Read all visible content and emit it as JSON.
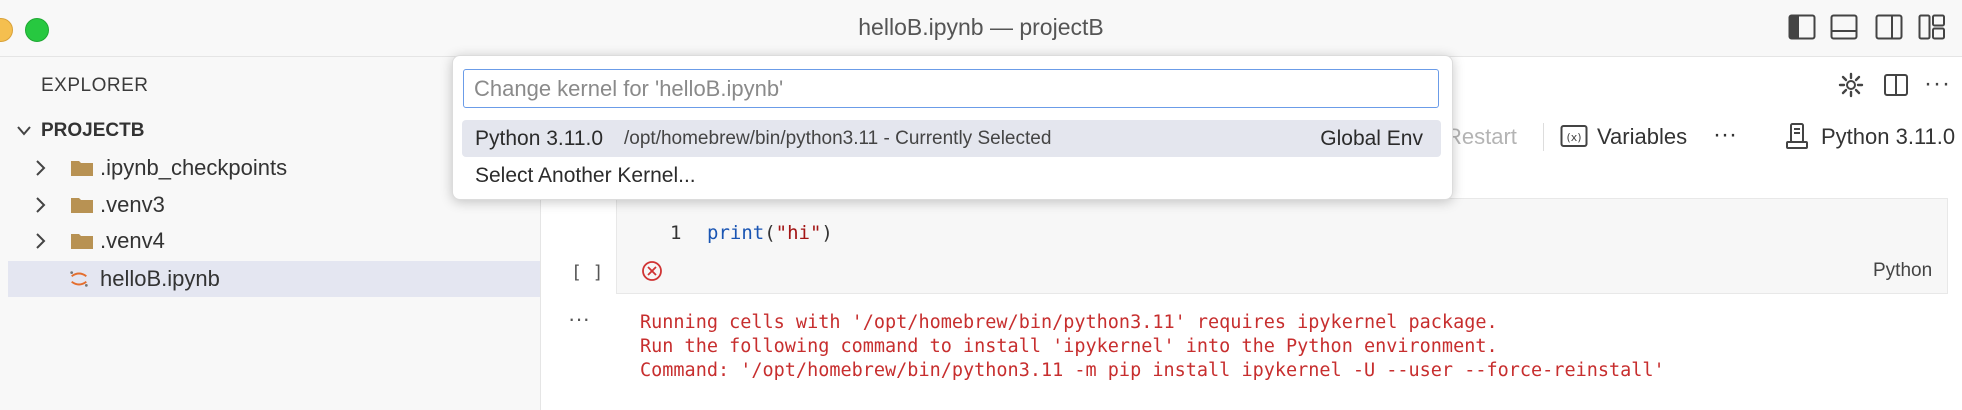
{
  "window": {
    "title": "helloB.ipynb — projectB"
  },
  "explorer": {
    "title": "EXPLORER",
    "root": "PROJECTB",
    "items": [
      {
        "label": ".ipynb_checkpoints",
        "type": "folder"
      },
      {
        "label": ".venv3",
        "type": "folder"
      },
      {
        "label": ".venv4",
        "type": "folder"
      },
      {
        "label": "helloB.ipynb",
        "type": "notebook",
        "selected": true
      }
    ]
  },
  "notebook_toolbar": {
    "restart_label": "Restart",
    "variables_label": "Variables",
    "more_label": "···",
    "kernel_label": "Python 3.11.0"
  },
  "cell": {
    "line_number": "1",
    "code_fn": "print",
    "code_open": "(",
    "code_str": "\"hi\"",
    "code_close": ")",
    "exec_brackets": "[ ]",
    "language": "Python",
    "output_menu": "···",
    "error_lines": [
      "Running cells with '/opt/homebrew/bin/python3.11' requires ipykernel package.",
      "Run the following command to install 'ipykernel' into the Python environment.",
      "Command: '/opt/homebrew/bin/python3.11 -m pip install ipykernel -U --user --force-reinstall'"
    ]
  },
  "quick_pick": {
    "placeholder": "Change kernel for 'helloB.ipynb'",
    "items": [
      {
        "label": "Python 3.11.0",
        "description": "/opt/homebrew/bin/python3.11 - Currently Selected",
        "detail": "Global Env"
      },
      {
        "label": "Select Another Kernel..."
      }
    ]
  },
  "colors": {
    "accent": "#3c7ce6",
    "error": "#c72e2e",
    "traffic_yellow": "#f5bf4f",
    "traffic_green": "#27c840"
  }
}
